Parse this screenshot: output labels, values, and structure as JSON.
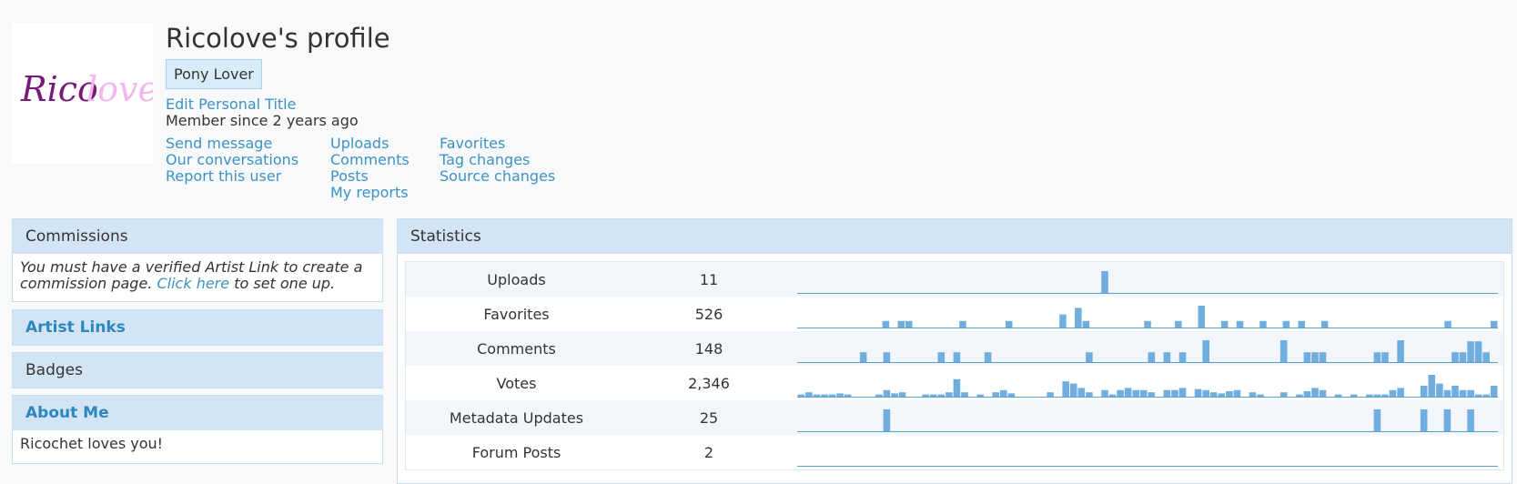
{
  "profile": {
    "avatar_text": "Ricolove",
    "name": "Ricolove's profile",
    "title_badge": "Pony Lover",
    "edit_title": "Edit Personal Title",
    "member_since": "Member since 2 years ago",
    "links": [
      [
        "Send message",
        "Our conversations",
        "Report this user"
      ],
      [
        "Uploads",
        "Comments",
        "Posts",
        "My reports"
      ],
      [
        "Favorites",
        "Tag changes",
        "Source changes"
      ]
    ]
  },
  "commissions": {
    "header": "Commissions",
    "text_before": "You must have a verified Artist Link to create a commission page.",
    "link": "Click here",
    "text_after": "to set one up."
  },
  "artist_links": {
    "header": "Artist Links"
  },
  "badges": {
    "header": "Badges"
  },
  "about_me": {
    "header": "About Me",
    "body": "Ricochet loves you!"
  },
  "statistics": {
    "header": "Statistics",
    "colors": {
      "bar": "#71aee0",
      "baseline": "#5aa0d2"
    },
    "rows": [
      {
        "label": "Uploads",
        "value": "11",
        "bars": [
          0,
          0,
          0,
          0,
          0,
          0,
          0,
          0,
          0,
          0,
          0,
          0,
          0,
          0,
          0,
          0,
          0,
          0,
          0,
          0,
          0,
          0,
          0,
          0,
          0,
          0,
          0,
          0,
          0,
          0,
          0,
          0,
          0,
          0,
          0,
          0,
          0,
          0,
          0,
          1,
          0,
          0,
          0,
          0,
          0,
          0,
          0,
          0,
          0,
          0,
          0,
          0,
          0,
          0,
          0,
          0,
          0,
          0,
          0,
          0,
          0,
          0,
          0,
          0,
          0,
          0,
          0,
          0,
          0,
          0,
          0,
          0,
          0,
          0,
          0,
          0,
          0,
          0,
          0,
          0,
          0,
          0,
          0,
          0,
          0,
          0,
          0,
          0,
          0,
          0
        ]
      },
      {
        "label": "Favorites",
        "value": "526",
        "bars": [
          0,
          0,
          0,
          0,
          0,
          0,
          0,
          0,
          0,
          0,
          0,
          0.3,
          0,
          0.3,
          0.3,
          0,
          0,
          0,
          0,
          0,
          0,
          0.3,
          0,
          0,
          0,
          0,
          0,
          0.3,
          0,
          0,
          0,
          0,
          0,
          0,
          0.6,
          0,
          0.9,
          0.3,
          0,
          0,
          0,
          0,
          0,
          0,
          0,
          0.3,
          0,
          0,
          0,
          0.3,
          0,
          0,
          1,
          0,
          0,
          0.3,
          0,
          0.3,
          0,
          0,
          0.3,
          0,
          0,
          0.3,
          0,
          0.3,
          0,
          0,
          0.3,
          0,
          0,
          0,
          0,
          0,
          0,
          0,
          0,
          0,
          0,
          0,
          0,
          0,
          0,
          0,
          0.3,
          0,
          0,
          0,
          0,
          0,
          0.3
        ]
      },
      {
        "label": "Comments",
        "value": "148",
        "bars": [
          0,
          0,
          0,
          0,
          0,
          0,
          0,
          0,
          0.45,
          0,
          0,
          0.45,
          0,
          0,
          0,
          0,
          0,
          0,
          0.45,
          0,
          0.45,
          0,
          0,
          0,
          0.45,
          0,
          0,
          0,
          0,
          0,
          0,
          0,
          0,
          0,
          0,
          0,
          0,
          0.45,
          0,
          0,
          0,
          0,
          0,
          0,
          0,
          0.45,
          0,
          0.45,
          0,
          0.45,
          0,
          0,
          1,
          0,
          0,
          0,
          0,
          0,
          0,
          0,
          0,
          0,
          1,
          0,
          0,
          0.45,
          0.45,
          0.45,
          0,
          0,
          0,
          0,
          0,
          0,
          0.45,
          0.45,
          0,
          1,
          0,
          0,
          0,
          0,
          0,
          0,
          0.45,
          0.45,
          0.95,
          0.95,
          0.45,
          0
        ]
      },
      {
        "label": "Votes",
        "value": "2,346",
        "bars": [
          0.1,
          0.2,
          0.1,
          0.1,
          0.1,
          0.15,
          0.1,
          0,
          0,
          0,
          0.1,
          0.3,
          0.15,
          0.2,
          0,
          0,
          0.1,
          0.1,
          0.1,
          0.2,
          0.8,
          0.2,
          0,
          0.1,
          0,
          0.2,
          0.3,
          0.15,
          0,
          0,
          0,
          0,
          0.2,
          0,
          0.7,
          0.6,
          0.4,
          0.2,
          0,
          0.3,
          0.1,
          0.3,
          0.4,
          0.3,
          0.3,
          0.2,
          0,
          0.3,
          0.3,
          0.4,
          0,
          0.35,
          0.3,
          0.2,
          0.15,
          0.25,
          0.3,
          0,
          0.2,
          0.1,
          0,
          0,
          0.2,
          0,
          0.1,
          0.25,
          0.4,
          0.3,
          0,
          0.1,
          0,
          0.1,
          0,
          0.1,
          0.1,
          0.1,
          0.3,
          0.4,
          0,
          0,
          0.5,
          1,
          0.6,
          0.3,
          0.5,
          0.3,
          0.3,
          0.1,
          0.1,
          0.5
        ]
      },
      {
        "label": "Metadata Updates",
        "value": "25",
        "bars": [
          0,
          0,
          0,
          0,
          0,
          0,
          0,
          0,
          0,
          0,
          0,
          1,
          0,
          0,
          0,
          0,
          0,
          0,
          0,
          0,
          0,
          0,
          0,
          0,
          0,
          0,
          0,
          0,
          0,
          0,
          0,
          0,
          0,
          0,
          0,
          0,
          0,
          0,
          0,
          0,
          0,
          0,
          0,
          0,
          0,
          0,
          0,
          0,
          0,
          0,
          0,
          0,
          0,
          0,
          0,
          0,
          0,
          0,
          0,
          0,
          0,
          0,
          0,
          0,
          0,
          0,
          0,
          0,
          0,
          0,
          0,
          0,
          0,
          0,
          1,
          0,
          0,
          0,
          0,
          0,
          1,
          0,
          0,
          1,
          0,
          0,
          1,
          0,
          0,
          0
        ]
      },
      {
        "label": "Forum Posts",
        "value": "2",
        "bars": [
          0,
          0,
          0,
          0,
          0,
          0,
          0,
          0,
          0,
          0,
          0,
          0,
          0,
          0,
          0,
          0,
          0,
          0,
          0,
          0,
          0,
          0,
          0,
          0,
          0,
          0,
          0,
          0,
          0,
          0,
          0,
          0,
          0,
          0,
          0,
          0,
          0,
          0,
          0,
          0,
          0,
          0,
          0,
          0,
          0,
          0,
          0,
          0,
          0,
          0,
          0,
          0,
          0,
          0,
          0,
          0,
          0,
          0,
          0,
          0,
          0,
          0,
          0,
          0,
          0,
          0,
          0,
          0,
          0,
          0,
          0,
          0,
          0,
          0,
          0,
          0,
          0,
          0,
          0,
          0,
          0,
          0,
          0,
          0,
          0,
          0,
          0,
          0,
          0,
          0
        ]
      }
    ]
  }
}
